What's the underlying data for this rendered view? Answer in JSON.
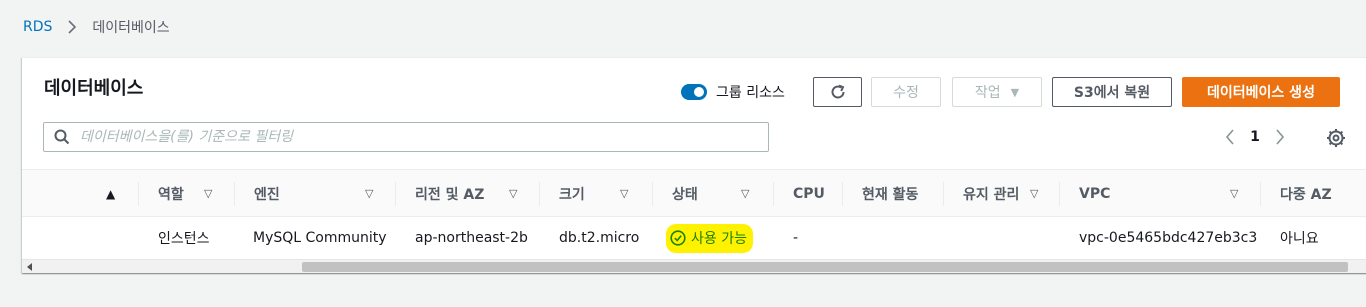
{
  "breadcrumb": {
    "root": "RDS",
    "current": "데이터베이스"
  },
  "panel": {
    "title": "데이터베이스",
    "group_toggle_label": "그룹 리소스",
    "group_toggle_on": true,
    "buttons": {
      "modify": "수정",
      "actions": "작업",
      "restore_s3": "S3에서 복원",
      "create": "데이터베이스 생성"
    },
    "search_placeholder": "데이터베이스을(를) 기준으로 필터링",
    "page": "1"
  },
  "table": {
    "columns": [
      "역할",
      "엔진",
      "리전 및 AZ",
      "크기",
      "상태",
      "CPU",
      "현재 활동",
      "유지 관리",
      "VPC",
      "다중 AZ"
    ],
    "rows": [
      {
        "role": "인스턴스",
        "engine": "MySQL Community",
        "region_az": "ap-northeast-2b",
        "size": "db.t2.micro",
        "status": "사용 가능",
        "cpu": "-",
        "activity": "",
        "maintenance": "",
        "vpc": "vpc-0e5465bdc427eb3c3",
        "multi_az": "아니요"
      }
    ]
  },
  "colors": {
    "link": "#0073bb",
    "primary": "#ec7211",
    "status_ok": "#1d8102",
    "highlight": "#fff200"
  }
}
